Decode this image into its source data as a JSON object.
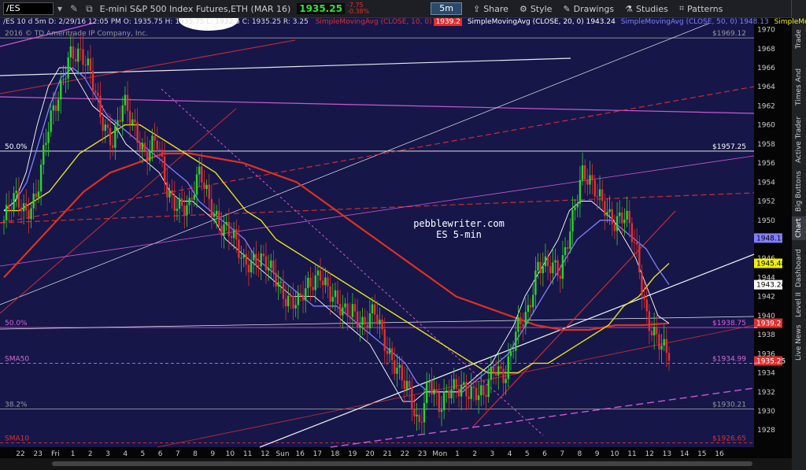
{
  "toolbar": {
    "symbol": "/ES",
    "description": "E-mini S&P 500 Index Futures,ETH (MAR 16)",
    "last_price": "1935.25",
    "change": "-7.75",
    "change_pct": "-0.38%",
    "timeframe": "5m",
    "share": "Share",
    "style": "Style",
    "drawings": "Drawings",
    "studies": "Studies",
    "patterns": "Patterns"
  },
  "sidebar": [
    "Trade",
    "Times And Sales",
    "Active Trader",
    "Big Buttons",
    "Chart",
    "Dashboard",
    "Level II",
    "Live News"
  ],
  "header": {
    "info": "/ES 10 d 5m  D: 2/29/16 12:05 PM  O: 1935.75  H: 1935.75  L: 1932.5  C: 1935.25  R: 3.25",
    "sma10": "SimpleMovingAvg (CLOSE, 10, 0)",
    "sma10_val": "1939.2",
    "sma20": "SimpleMovingAvg (CLOSE, 20, 0)",
    "sma20_val": "1943.24",
    "sma50": "SimpleMovingAvg (CLOSE, 50, 0)",
    "sma50_val": "1948.13",
    "sma_extra": "SimpleMoving...",
    "copyright": "2016 © TD Ameritrade IP Company, Inc."
  },
  "annotation": {
    "line1": "pebblewriter.com",
    "line2": "ES 5-min"
  },
  "levels": [
    {
      "label": "",
      "price": 1969.12,
      "tag": "$1969.12",
      "color": "#9a9a9a"
    },
    {
      "label": "50.0%",
      "price": 1957.25,
      "tag": "$1957.25",
      "color": "#ffffff"
    },
    {
      "label": "50.0%",
      "price": 1938.75,
      "tag": "$1938.75",
      "color": "#e060e0"
    },
    {
      "label": "SMA50",
      "price": 1934.99,
      "tag": "$1934.99",
      "color": "#d070d0"
    },
    {
      "label": "38.2%",
      "price": 1930.21,
      "tag": "$1930.21",
      "color": "#9a9a9a"
    },
    {
      "label": "SMA10",
      "price": 1926.65,
      "tag": "$1926.65",
      "color": "#e03030"
    }
  ],
  "price_tags": [
    {
      "value": "1948.13",
      "price": 1948.13,
      "bg": "#8080ff",
      "fg": "#000000"
    },
    {
      "value": "1945.48",
      "price": 1945.48,
      "bg": "#f0f000",
      "fg": "#000000"
    },
    {
      "value": "1943.24",
      "price": 1943.24,
      "bg": "#ffffff",
      "fg": "#000000"
    },
    {
      "value": "1939.2",
      "price": 1939.2,
      "bg": "#e03030",
      "fg": "#ffffff"
    },
    {
      "value": "1935.25",
      "price": 1935.25,
      "bg": "#e03030",
      "fg": "#ffffff"
    }
  ],
  "chart_data": {
    "type": "candlestick",
    "ylim": [
      1926.2,
      1971.2
    ],
    "yticks": [
      1928,
      1930,
      1932,
      1934,
      1936,
      1938,
      1940,
      1942,
      1944,
      1946,
      1948,
      1950,
      1952,
      1954,
      1956,
      1958,
      1960,
      1962,
      1964,
      1966,
      1968,
      1970
    ],
    "xticks": [
      "22",
      "23",
      "Fri",
      "1",
      "2",
      "3",
      "4",
      "5",
      "6",
      "7",
      "8",
      "9",
      "10",
      "11",
      "12",
      "Sun",
      "16",
      "17",
      "18",
      "19",
      "20",
      "21",
      "22",
      "23",
      "Mon",
      "1",
      "2",
      "3",
      "4",
      "5",
      "6",
      "7",
      "8",
      "9",
      "10",
      "11",
      "12",
      "13",
      "14",
      "15",
      "16"
    ],
    "close_path": [
      1950,
      1952,
      1951,
      1953,
      1959,
      1963,
      1968,
      1967,
      1965,
      1961,
      1958,
      1962,
      1960,
      1957,
      1958,
      1953,
      1952,
      1951,
      1955,
      1952,
      1949,
      1948,
      1946,
      1946,
      1945,
      1944,
      1942,
      1941,
      1943,
      1945,
      1942,
      1940,
      1941,
      1939,
      1940,
      1937,
      1935,
      1932,
      1928,
      1934,
      1930,
      1932,
      1933,
      1932,
      1931,
      1935,
      1934,
      1938,
      1940,
      1946,
      1945,
      1944,
      1950,
      1955,
      1953,
      1952,
      1950,
      1950,
      1947,
      1940,
      1937,
      1935.25
    ],
    "sma10": [
      1951,
      1952,
      1955,
      1960,
      1964,
      1966,
      1966,
      1964,
      1962,
      1961,
      1960,
      1958,
      1957,
      1956,
      1955,
      1953,
      1952,
      1952,
      1951,
      1950,
      1948,
      1947,
      1946,
      1945,
      1944,
      1943,
      1942,
      1942,
      1942,
      1941,
      1940,
      1939,
      1938,
      1937,
      1935,
      1933,
      1931,
      1931,
      1932,
      1932,
      1932,
      1932,
      1933,
      1934,
      1935,
      1937,
      1939,
      1942,
      1944,
      1946,
      1948,
      1951,
      1952,
      1952,
      1951,
      1950,
      1948,
      1946,
      1943,
      1940,
      1939.2
    ],
    "sma20": [
      1951,
      1952,
      1954,
      1958,
      1962,
      1965,
      1966,
      1965,
      1963,
      1961,
      1960,
      1959,
      1958,
      1957,
      1956,
      1955,
      1954,
      1952,
      1951,
      1950,
      1949,
      1948,
      1946,
      1945,
      1944,
      1943,
      1942,
      1941,
      1941,
      1941,
      1940,
      1939,
      1938,
      1937,
      1936,
      1935,
      1933,
      1932,
      1932,
      1932,
      1932,
      1933,
      1934,
      1935,
      1936,
      1938,
      1940,
      1942,
      1944,
      1946,
      1948,
      1949,
      1950,
      1950,
      1949,
      1948,
      1947,
      1945,
      1943.24
    ],
    "sma50": [
      1951,
      1951,
      1952,
      1953,
      1955,
      1957,
      1958,
      1959,
      1960,
      1960,
      1959,
      1958,
      1957,
      1956,
      1955,
      1953,
      1951,
      1950,
      1948,
      1947,
      1946,
      1945,
      1944,
      1943,
      1942,
      1941,
      1940,
      1939,
      1938,
      1937,
      1936,
      1935,
      1934,
      1934,
      1934,
      1935,
      1935,
      1936,
      1937,
      1938,
      1939,
      1941,
      1942,
      1944,
      1945.48
    ],
    "sma200": [
      1944,
      1947,
      1950,
      1953,
      1955,
      1956,
      1957,
      1957,
      1956.5,
      1956,
      1955,
      1954,
      1952,
      1950,
      1948,
      1946,
      1944,
      1942,
      1941,
      1940,
      1939,
      1938.5,
      1938.5,
      1939,
      1939,
      1939.2
    ]
  }
}
